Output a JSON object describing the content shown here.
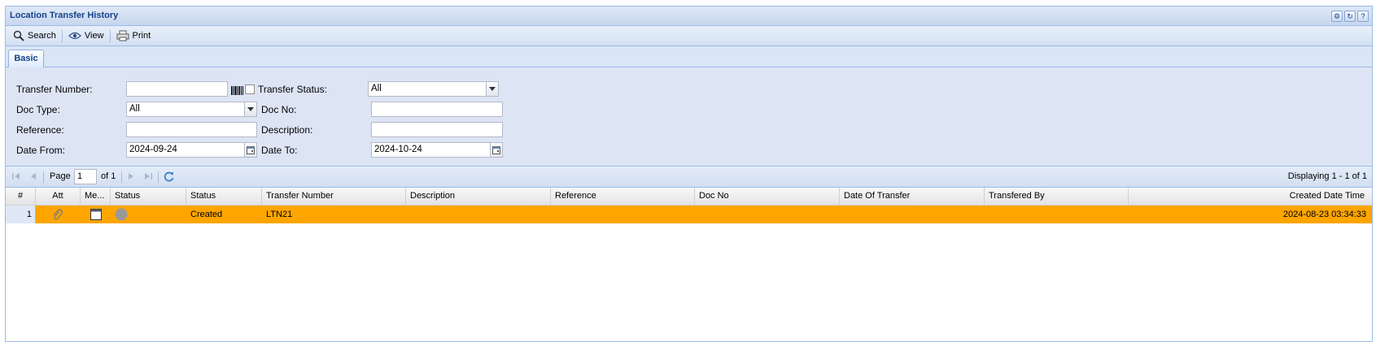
{
  "window": {
    "title": "Location Transfer History",
    "tool_icons": [
      "gear-icon",
      "refresh-icon",
      "help-icon"
    ]
  },
  "toolbar": {
    "search_label": "Search",
    "view_label": "View",
    "print_label": "Print"
  },
  "tabs": [
    {
      "label": "Basic"
    }
  ],
  "form": {
    "transfer_number": {
      "label": "Transfer Number:",
      "value": ""
    },
    "transfer_status": {
      "label": "Transfer Status:",
      "value": "All"
    },
    "doc_type": {
      "label": "Doc Type:",
      "value": "All"
    },
    "doc_no": {
      "label": "Doc No:",
      "value": ""
    },
    "reference": {
      "label": "Reference:",
      "value": ""
    },
    "description": {
      "label": "Description:",
      "value": ""
    },
    "date_from": {
      "label": "Date From:",
      "value": "2024-09-24"
    },
    "date_to": {
      "label": "Date To:",
      "value": "2024-10-24"
    }
  },
  "pager": {
    "page_label": "Page",
    "page_value": "1",
    "of_label": "of 1",
    "display_text": "Displaying 1 - 1 of 1"
  },
  "grid": {
    "columns": [
      "#",
      "Att",
      "Me...",
      "Status",
      "Status",
      "Transfer Number",
      "Description",
      "Reference",
      "Doc No",
      "Date Of Transfer",
      "Transfered By",
      "Created Date Time"
    ],
    "rows": [
      {
        "num": "1",
        "status": "Created",
        "transfer_number": "LTN21",
        "description": "",
        "reference": "",
        "doc_no": "",
        "date_of_transfer": "",
        "transfered_by": "",
        "created": "2024-08-23 03:34:33"
      }
    ]
  },
  "colors": {
    "selected_row": "#ffa500",
    "header_text": "#15428b",
    "form_bg": "#dde5f5"
  }
}
